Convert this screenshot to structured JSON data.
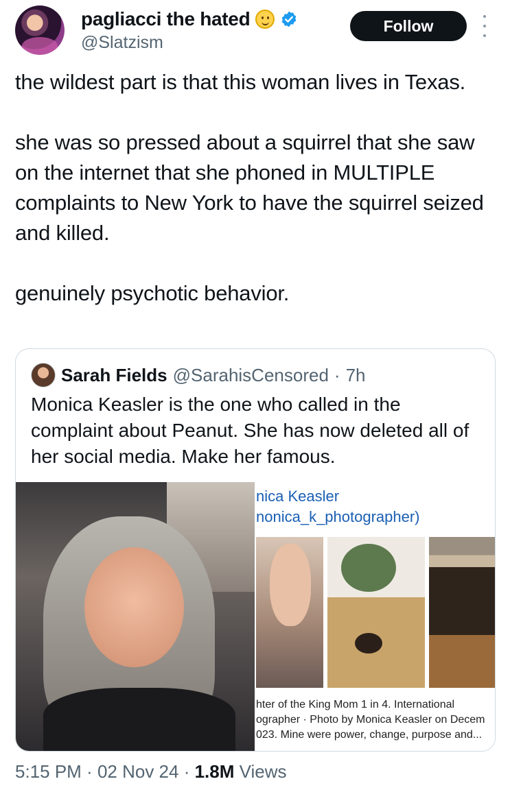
{
  "author": {
    "display_name": "pagliacci the hated",
    "handle": "@Slatzism",
    "name_emoji": "smiling-face-emoji",
    "verified": true
  },
  "actions": {
    "follow_label": "Follow",
    "more_icon": "more-vertical-icon"
  },
  "tweet": {
    "paragraphs": [
      "the wildest part is that this woman lives in Texas.",
      "she was so pressed about a squirrel that she saw on the internet that she phoned in MULTIPLE complaints to New York to have the squirrel seized and killed.",
      "genuinely psychotic behavior."
    ]
  },
  "quote": {
    "name": "Sarah Fields",
    "handle": "@SarahisCensored",
    "separator": "·",
    "age": "7h",
    "text": "Monica Keasler is the one who called in the complaint about Peanut. She has now deleted all of her social media. Make her famous.",
    "media": {
      "cut_name": "nica Keasler",
      "cut_handle": "nonica_k_photographer)",
      "caption_lines": [
        "hter of the King Mom 1 in 4. International",
        "ographer · Photo by Monica Keasler on Decem",
        "023. Mine were power, change, purpose and..."
      ]
    }
  },
  "footer": {
    "time": "5:15 PM",
    "sep1": " · ",
    "date": "02 Nov 24",
    "sep2": " · ",
    "views_count": "1.8M",
    "views_label": " Views"
  },
  "colors": {
    "text": "#0f1419",
    "secondary": "#536471",
    "verified": "#1d9bf0",
    "follow_bg": "#0f1419",
    "link": "#1a5fb4"
  }
}
